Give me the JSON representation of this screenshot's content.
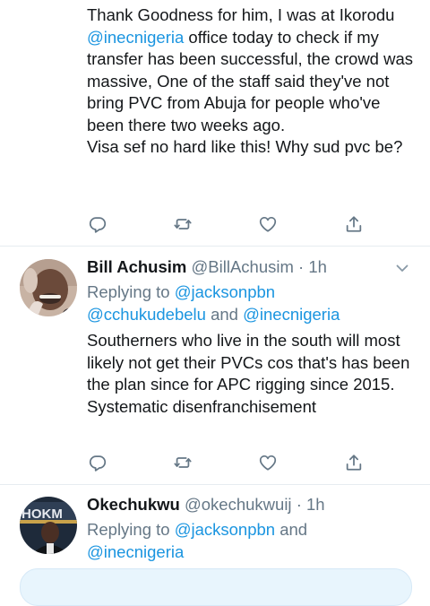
{
  "tweet1": {
    "segments": [
      {
        "text": "Thank Goodness for him, I was at Ikorodu ",
        "mention": false
      },
      {
        "text": "@inecnigeria",
        "mention": true
      },
      {
        "text": " office today to check if my transfer has been successful, the crowd was massive, One of the staff said they've not bring PVC from Abuja for people who've been there two weeks ago.",
        "mention": false
      }
    ],
    "line2": "Visa sef no hard like this! Why sud pvc be?"
  },
  "tweet2": {
    "name": "Bill Achusim",
    "handle": "@BillAchusim",
    "dot": "·",
    "time": "1h",
    "replying_prefix": "Replying to ",
    "replying_to_1": "@jacksonpbn",
    "replying_to_2": "@cchukudebelu",
    "replying_and": " and ",
    "replying_to_3": "@inecnigeria",
    "text_line1": "Southerners who live in the south will most likely not get their PVCs cos that's has been the plan since for APC rigging since 2015.",
    "text_line2": "Systematic disenfranchisement"
  },
  "tweet3": {
    "name": "Okechukwu",
    "handle": "@okechukwuij",
    "dot": "·",
    "time": "1h",
    "replying_prefix": "Replying to ",
    "replying_to_1": "@jacksonpbn",
    "replying_and": " and",
    "replying_to_2": "@inecnigeria"
  },
  "icons": {
    "reply": "reply-icon",
    "retweet": "retweet-icon",
    "like": "heart-icon",
    "share": "share-icon",
    "more": "chevron-down-icon"
  },
  "colors": {
    "link": "#1b95e0",
    "secondary": "#657786",
    "icon": "#657786",
    "divider": "#e6ecf0",
    "compose_bg": "#e8f5fd"
  }
}
